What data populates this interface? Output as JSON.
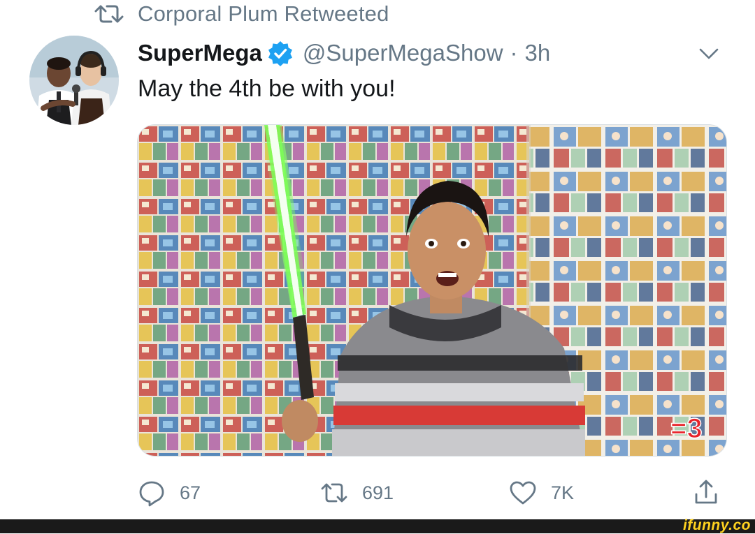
{
  "retweet_header": {
    "icon": "retweet-icon",
    "label": "Corporal Plum Retweeted"
  },
  "tweet": {
    "author": {
      "display_name": "SuperMega",
      "verified": true,
      "handle": "@SuperMegaShow",
      "separator": "·",
      "time": "3h"
    },
    "text": "May the 4th be with you!",
    "media": {
      "overlay_text": "=3"
    },
    "actions": {
      "reply": {
        "icon": "reply-icon",
        "count": "67"
      },
      "retweet": {
        "icon": "retweet-icon",
        "count": "691"
      },
      "like": {
        "icon": "heart-icon",
        "count": "7K"
      },
      "share": {
        "icon": "share-icon"
      }
    }
  },
  "watermark": {
    "text": "ifunny.co"
  },
  "colors": {
    "text_primary": "#14171a",
    "text_secondary": "#657786",
    "verified_blue": "#1da1f2",
    "watermark_yellow": "#ffd21f"
  }
}
